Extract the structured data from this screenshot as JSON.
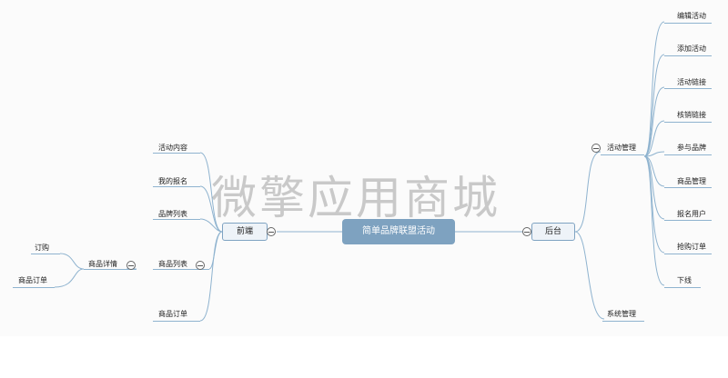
{
  "root": "简单品牌联盟活动",
  "left_branch": {
    "label": "前端",
    "children": [
      "活动内容",
      "我的报名",
      "品牌列表",
      "商品列表",
      "商品订单"
    ],
    "product_detail": {
      "label": "商品详情",
      "children": [
        "订购",
        "商品订单"
      ]
    }
  },
  "right_branch": {
    "label": "后台",
    "activity_management": {
      "label": "活动管理",
      "children": [
        "编辑活动",
        "添加活动",
        "活动链接",
        "核销链接",
        "参与品牌",
        "商品管理",
        "报名用户",
        "抢购订单",
        "下线"
      ]
    },
    "system_management": "系统管理"
  },
  "watermark": "微擎应用商城",
  "colors": {
    "root_fill": "#7ea2c0",
    "line": "#8fb3cf",
    "box_fill": "#eef3f8"
  }
}
